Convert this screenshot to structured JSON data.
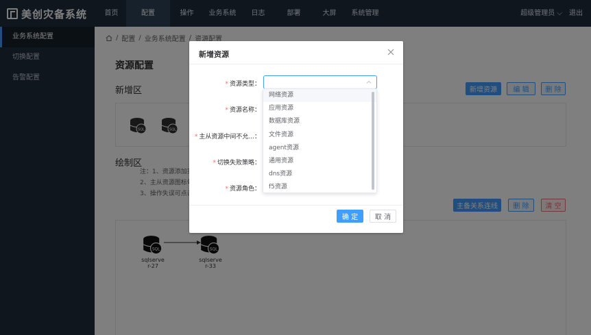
{
  "app": {
    "title": "美创灾备系统"
  },
  "nav": {
    "items": [
      "首页",
      "配置",
      "操作",
      "业务系统",
      "日志",
      "部署",
      "大屏",
      "系统管理"
    ],
    "active_index": 1
  },
  "user": {
    "name": "超级管理员 ⌵",
    "logout": "退出"
  },
  "sidebar": {
    "items": [
      "业务系统配置",
      "切换配置",
      "告警配置"
    ],
    "active_index": 0
  },
  "breadcrumb": {
    "items": [
      "配置",
      "业务系统配置",
      "资源配置"
    ],
    "separator": "/"
  },
  "page": {
    "title": "资源配置",
    "add_area_title": "新增区",
    "draw_area_title": "绘制区",
    "notes": [
      "注：1、资源添加实",
      "2、主从资源图标勾",
      "3、操作失误可点击"
    ]
  },
  "toolbar_top": {
    "add": "新增资源",
    "edit": "编 辑",
    "delete": "删 除"
  },
  "toolbar_draw": {
    "link": "主备关系连线",
    "delete": "删 除",
    "clear": "清 空"
  },
  "canvas_nodes": [
    {
      "label_line1": "sqlserve",
      "label_line2": "r-27"
    },
    {
      "label_line1": "sqlserve",
      "label_line2": "r-33"
    }
  ],
  "dialog": {
    "title": "新增资源",
    "fields": [
      "资源类型：",
      "资源名称：",
      "主从资源中间不允...：",
      "切换失败策略：",
      "资源角色："
    ],
    "select_value": "",
    "confirm": "确 定",
    "cancel": "取 消"
  },
  "dropdown": {
    "options": [
      "网络资源",
      "应用资源",
      "数据库资源",
      "文件资源",
      "agent资源",
      "通用资源",
      "dns资源",
      "f5资源"
    ],
    "hover_index": 0
  },
  "colors": {
    "nav_bg": "#1f2d3d",
    "primary": "#409eff",
    "danger": "#f56c6c"
  }
}
